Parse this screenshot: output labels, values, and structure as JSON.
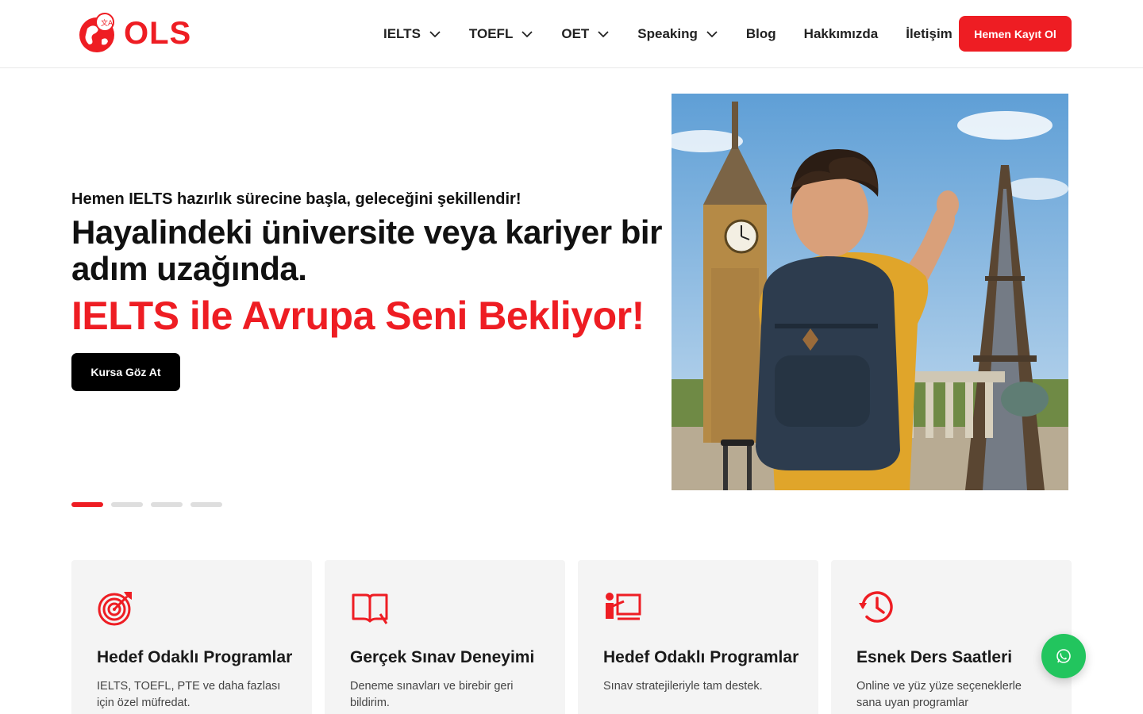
{
  "brand": {
    "name": "OLS",
    "accent_color": "#ee1d23"
  },
  "nav": {
    "items": [
      {
        "label": "IELTS",
        "has_dropdown": true
      },
      {
        "label": "TOEFL",
        "has_dropdown": true
      },
      {
        "label": "OET",
        "has_dropdown": true
      },
      {
        "label": "Speaking",
        "has_dropdown": true
      },
      {
        "label": "Blog",
        "has_dropdown": false
      },
      {
        "label": "Hakkımızda",
        "has_dropdown": false
      },
      {
        "label": "İletişim",
        "has_dropdown": false
      }
    ],
    "cta_label": "Hemen Kayıt Ol"
  },
  "hero": {
    "subtitle": "Hemen IELTS hazırlık sürecine başla, geleceğini şekillendir!",
    "title": "Hayalindeki üniversite veya kariyer bir adım uzağında.",
    "accent": "IELTS ile Avrupa Seni Bekliyor!",
    "button_label": "Kursa Göz At",
    "slides_count": 4,
    "active_slide": 0,
    "image_icon": "student-landmarks-image"
  },
  "features": [
    {
      "icon": "target-icon",
      "title": "Hedef Odaklı Programlar",
      "desc": "IELTS, TOEFL, PTE ve daha fazlası için özel müfredat."
    },
    {
      "icon": "open-book-icon",
      "title": "Gerçek Sınav Deneyimi",
      "desc": "Deneme sınavları ve birebir geri bildirim."
    },
    {
      "icon": "teacher-board-icon",
      "title": "Hedef Odaklı Programlar",
      "desc": "Sınav stratejileriyle tam destek."
    },
    {
      "icon": "history-clock-icon",
      "title": "Esnek Ders Saatleri",
      "desc": "Online ve yüz yüze seçeneklerle sana uyan programlar"
    }
  ],
  "whatsapp": {
    "icon": "whatsapp-icon",
    "color": "#22c55e"
  }
}
